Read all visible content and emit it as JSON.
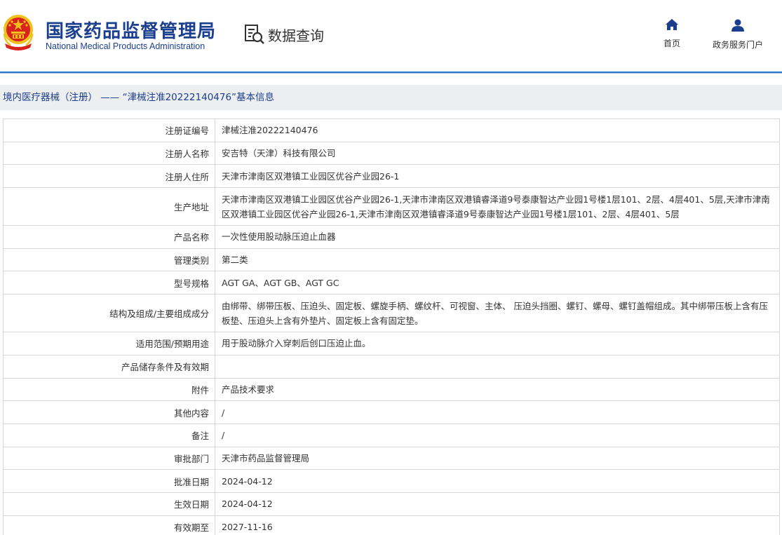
{
  "header": {
    "logo_cn": "国家药品监督管理局",
    "logo_en": "National Medical Products Administration",
    "query_label": "数据查询",
    "nav": [
      {
        "label": "首页",
        "icon": "home-icon"
      },
      {
        "label": "政务服务门户",
        "icon": "user-icon"
      }
    ]
  },
  "breadcrumb": "境内医疗器械（注册） —— “津械注准20222140476”基本信息",
  "rows": [
    {
      "label": "注册证编号",
      "value": "津械注准20222140476"
    },
    {
      "label": "注册人名称",
      "value": "安吉特（天津）科技有限公司"
    },
    {
      "label": "注册人住所",
      "value": "天津市津南区双港镇工业园区优谷产业园26-1"
    },
    {
      "label": "生产地址",
      "value": "天津市津南区双港镇工业园区优谷产业园26-1,天津市津南区双港镇睿泽道9号泰康智达产业园1号楼1层101、2层、4层401、5层,天津市津南区双港镇工业园区优谷产业园26-1,天津市津南区双港镇睿泽道9号泰康智达产业园1号楼1层101、2层、4层401、5层"
    },
    {
      "label": "产品名称",
      "value": "一次性使用股动脉压迫止血器"
    },
    {
      "label": "管理类别",
      "value": "第二类"
    },
    {
      "label": "型号规格",
      "value": "AGT GA、AGT GB、AGT GC"
    },
    {
      "label": "结构及组成/主要组成成分",
      "value": "由绑带、绑带压板、压迫头、固定板、螺旋手柄、螺纹杆、可视窗、主体、 压迫头挡圈、螺钉、螺母、螺钉盖帽组成。其中绑带压板上含有压板垫、压迫头上含有外垫片、固定板上含有固定垫。"
    },
    {
      "label": "适用范围/预期用途",
      "value": "用于股动脉介入穿刺后创口压迫止血。"
    },
    {
      "label": "产品储存条件及有效期",
      "value": ""
    },
    {
      "label": "附件",
      "value": "产品技术要求"
    },
    {
      "label": "其他内容",
      "value": "/"
    },
    {
      "label": "备注",
      "value": "/"
    },
    {
      "label": "审批部门",
      "value": "天津市药品监督管理局"
    },
    {
      "label": "批准日期",
      "value": "2024-04-12"
    },
    {
      "label": "生效日期",
      "value": "2024-04-12"
    },
    {
      "label": "有效期至",
      "value": "2027-11-16"
    }
  ],
  "colors": {
    "brand": "#1b3f8f",
    "rule": "#2b78c9",
    "emblem_red": "#d8231e",
    "emblem_gold": "#f1c21b"
  }
}
